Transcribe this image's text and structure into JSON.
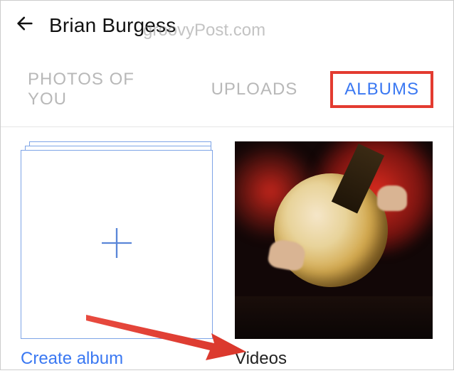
{
  "header": {
    "title": "Brian Burgess"
  },
  "watermark": "groovyPost.com",
  "tabs": {
    "photos_of_you": "PHOTOS OF YOU",
    "uploads": "UPLOADS",
    "albums": "ALBUMS"
  },
  "albums": {
    "create_label": "Create album",
    "videos_label": "Videos"
  }
}
